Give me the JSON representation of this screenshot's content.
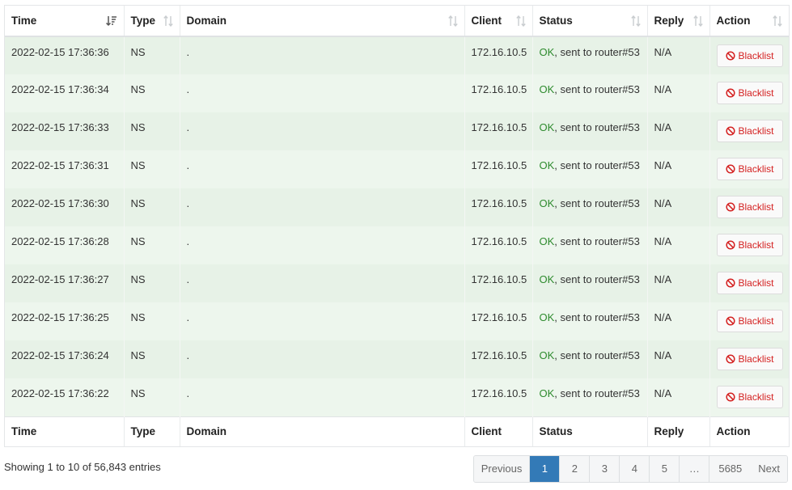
{
  "columns": [
    {
      "label": "Time"
    },
    {
      "label": "Type"
    },
    {
      "label": "Domain"
    },
    {
      "label": "Client"
    },
    {
      "label": "Status"
    },
    {
      "label": "Reply"
    },
    {
      "label": "Action"
    }
  ],
  "rows": [
    {
      "time": "2022-02-15 17:36:36",
      "type": "NS",
      "domain": ".",
      "client": "172.16.10.5",
      "status_ok": "OK",
      "status_rest": ", sent to router#53",
      "reply": "N/A",
      "action": "Blacklist"
    },
    {
      "time": "2022-02-15 17:36:34",
      "type": "NS",
      "domain": ".",
      "client": "172.16.10.5",
      "status_ok": "OK",
      "status_rest": ", sent to router#53",
      "reply": "N/A",
      "action": "Blacklist"
    },
    {
      "time": "2022-02-15 17:36:33",
      "type": "NS",
      "domain": ".",
      "client": "172.16.10.5",
      "status_ok": "OK",
      "status_rest": ", sent to router#53",
      "reply": "N/A",
      "action": "Blacklist"
    },
    {
      "time": "2022-02-15 17:36:31",
      "type": "NS",
      "domain": ".",
      "client": "172.16.10.5",
      "status_ok": "OK",
      "status_rest": ", sent to router#53",
      "reply": "N/A",
      "action": "Blacklist"
    },
    {
      "time": "2022-02-15 17:36:30",
      "type": "NS",
      "domain": ".",
      "client": "172.16.10.5",
      "status_ok": "OK",
      "status_rest": ", sent to router#53",
      "reply": "N/A",
      "action": "Blacklist"
    },
    {
      "time": "2022-02-15 17:36:28",
      "type": "NS",
      "domain": ".",
      "client": "172.16.10.5",
      "status_ok": "OK",
      "status_rest": ", sent to router#53",
      "reply": "N/A",
      "action": "Blacklist"
    },
    {
      "time": "2022-02-15 17:36:27",
      "type": "NS",
      "domain": ".",
      "client": "172.16.10.5",
      "status_ok": "OK",
      "status_rest": ", sent to router#53",
      "reply": "N/A",
      "action": "Blacklist"
    },
    {
      "time": "2022-02-15 17:36:25",
      "type": "NS",
      "domain": ".",
      "client": "172.16.10.5",
      "status_ok": "OK",
      "status_rest": ", sent to router#53",
      "reply": "N/A",
      "action": "Blacklist"
    },
    {
      "time": "2022-02-15 17:36:24",
      "type": "NS",
      "domain": ".",
      "client": "172.16.10.5",
      "status_ok": "OK",
      "status_rest": ", sent to router#53",
      "reply": "N/A",
      "action": "Blacklist"
    },
    {
      "time": "2022-02-15 17:36:22",
      "type": "NS",
      "domain": ".",
      "client": "172.16.10.5",
      "status_ok": "OK",
      "status_rest": ", sent to router#53",
      "reply": "N/A",
      "action": "Blacklist"
    }
  ],
  "info_text": "Showing 1 to 10 of 56,843 entries",
  "pagination": {
    "previous": "Previous",
    "pages": [
      "1",
      "2",
      "3",
      "4",
      "5",
      "…",
      "5685"
    ],
    "current": "1",
    "next": "Next"
  },
  "colors": {
    "ok": "#2e8b2e",
    "blacklist": "#d42020",
    "active_page": "#337ab7"
  },
  "icons": {
    "sort_active": "sort-desc-icon",
    "sort": "sort-icon",
    "blacklist": "ban-icon"
  }
}
